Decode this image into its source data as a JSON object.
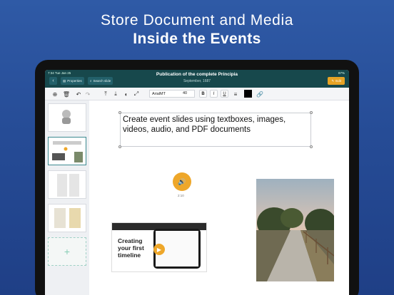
{
  "hero": {
    "line1": "Store Document and Media",
    "line2": "Inside the Events"
  },
  "status": {
    "left": "7:34  Tue Jan 25",
    "right": "87%"
  },
  "topbar": {
    "title": "Publication of the complete Principia",
    "date": "September, 1687",
    "properties_label": "Properties",
    "search_label": "Search slide",
    "edit_label": "Edit"
  },
  "toolbar": {
    "font": "ArialMT",
    "size": "40",
    "bold": "B",
    "italic": "I",
    "underline": "U"
  },
  "slide": {
    "textbox": "Create event slides using textboxes, images, videos, audio, and PDF documents",
    "audio_duration": "2:10",
    "video_title": "Creating your first timeline"
  },
  "colors": {
    "accent": "#e7a325",
    "topbar": "#17484c",
    "background": "#2b529c"
  }
}
